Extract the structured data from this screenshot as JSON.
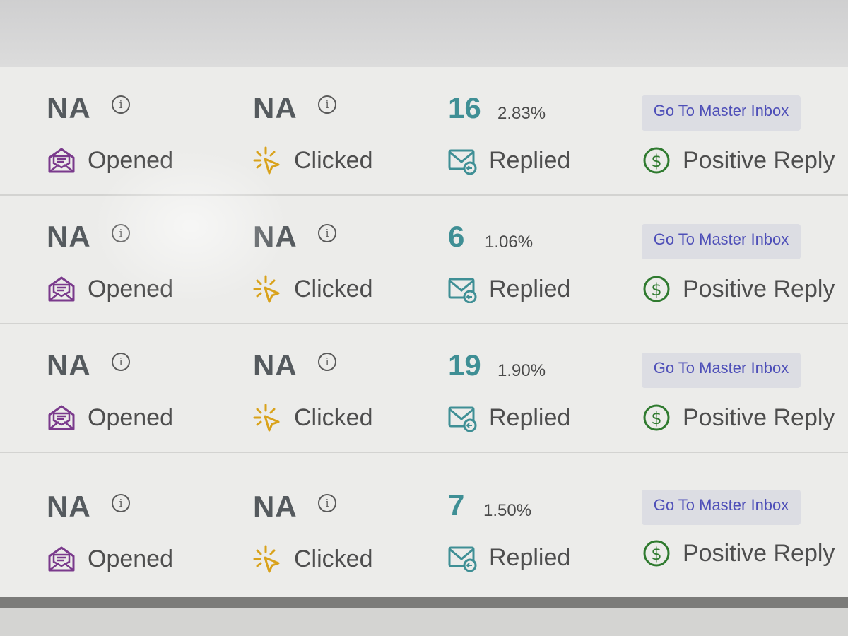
{
  "icons": {
    "opened": "envelope-open-icon",
    "clicked": "cursor-click-icon",
    "replied": "envelope-reply-icon",
    "positive": "dollar-circle-icon",
    "info": "info-icon"
  },
  "colors": {
    "opened_icon": "#7a3a8c",
    "clicked_icon": "#d9a21b",
    "replied_icon": "#3f8f95",
    "positive_icon": "#2f7a2f",
    "link": "#4e4fb8",
    "count": "#3f8f95"
  },
  "rows": [
    {
      "opened_value": "NA",
      "clicked_value": "NA",
      "replied_count": "16",
      "replied_pct": "2.83%",
      "opened_label": "Opened",
      "clicked_label": "Clicked",
      "replied_label": "Replied",
      "positive_label": "Positive Reply",
      "inbox_link": "Go To Master Inbox"
    },
    {
      "opened_value": "NA",
      "clicked_value": "NA",
      "replied_count": "6",
      "replied_pct": "1.06%",
      "opened_label": "Opened",
      "clicked_label": "Clicked",
      "replied_label": "Replied",
      "positive_label": "Positive Reply",
      "inbox_link": "Go To Master Inbox"
    },
    {
      "opened_value": "NA",
      "clicked_value": "NA",
      "replied_count": "19",
      "replied_pct": "1.90%",
      "opened_label": "Opened",
      "clicked_label": "Clicked",
      "replied_label": "Replied",
      "positive_label": "Positive Reply",
      "inbox_link": "Go To Master Inbox"
    },
    {
      "opened_value": "NA",
      "clicked_value": "NA",
      "replied_count": "7",
      "replied_pct": "1.50%",
      "opened_label": "Opened",
      "clicked_label": "Clicked",
      "replied_label": "Replied",
      "positive_label": "Positive Reply",
      "inbox_link": "Go To Master Inbox"
    }
  ]
}
